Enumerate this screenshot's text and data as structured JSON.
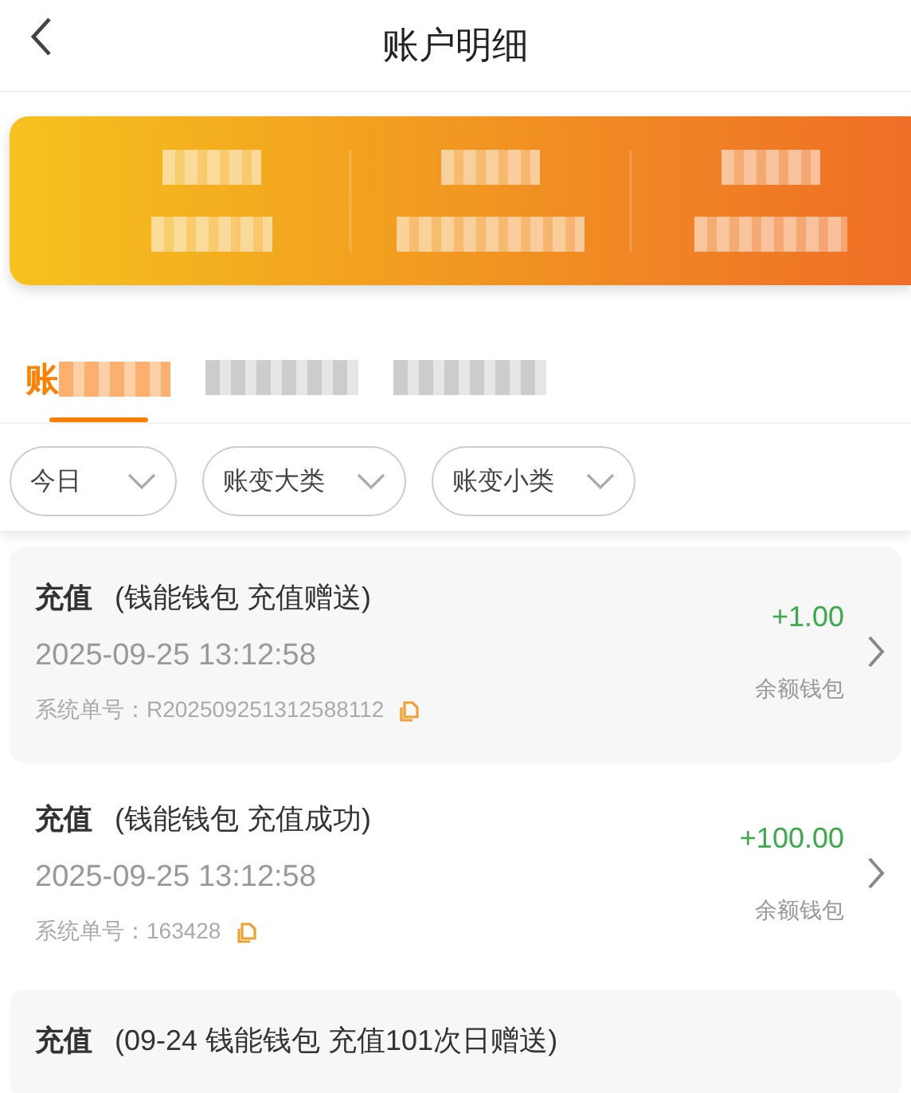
{
  "header": {
    "title": "账户明细"
  },
  "tabs": [
    {
      "label": "账",
      "selected": true
    },
    {
      "selected": false
    },
    {
      "selected": false
    }
  ],
  "filters": [
    {
      "label": "今日"
    },
    {
      "label": "账变大类"
    },
    {
      "label": "账变小类"
    }
  ],
  "records": [
    {
      "type": "充值",
      "detail": "(钱能钱包 充值赠送)",
      "time": "2025-09-25 13:12:58",
      "order_label": "系统单号：",
      "order_no": "R202509251312588112",
      "amount": "+1.00",
      "wallet": "余额钱包"
    },
    {
      "type": "充值",
      "detail": "(钱能钱包 充值成功)",
      "time": "2025-09-25 13:12:58",
      "order_label": "系统单号：",
      "order_no": "163428",
      "amount": "+100.00",
      "wallet": "余额钱包"
    },
    {
      "type": "充值",
      "detail": "(09-24 钱能钱包 充值101次日赠送)"
    }
  ]
}
